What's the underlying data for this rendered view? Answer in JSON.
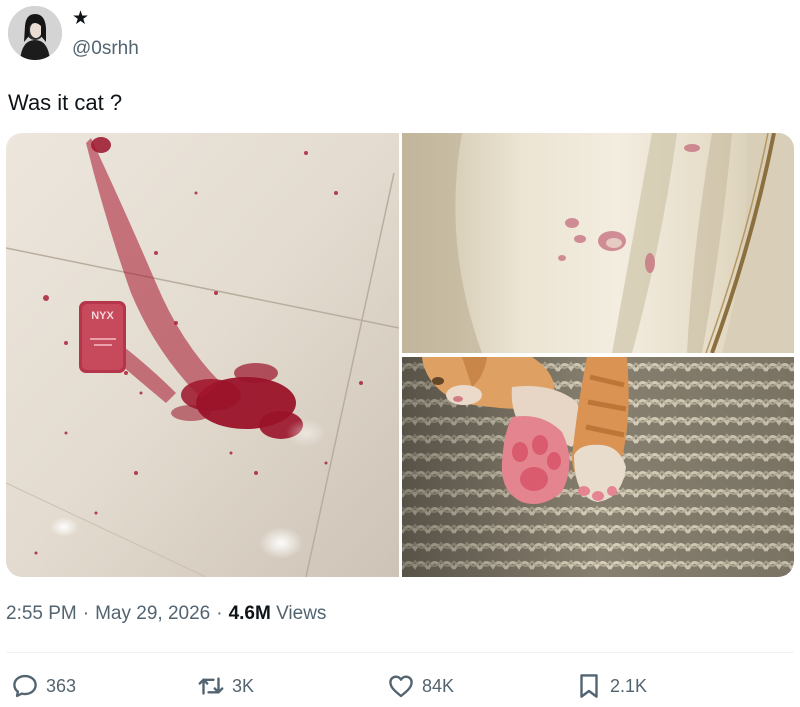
{
  "author": {
    "badge": "★",
    "handle": "@0srhh"
  },
  "tweet": {
    "text": "Was it cat ?"
  },
  "media": {
    "product_brand": "NYX"
  },
  "meta": {
    "time": "2:55 PM",
    "separator": "·",
    "date": "May 29, 2026",
    "views_count": "4.6M",
    "views_label": "Views"
  },
  "actions": {
    "replies": "363",
    "reposts": "3K",
    "likes": "84K",
    "bookmarks": "2.1K"
  },
  "colors": {
    "text_primary": "#0f1419",
    "text_secondary": "#536471",
    "divider": "#eff3f4",
    "blush": "#a01228"
  }
}
